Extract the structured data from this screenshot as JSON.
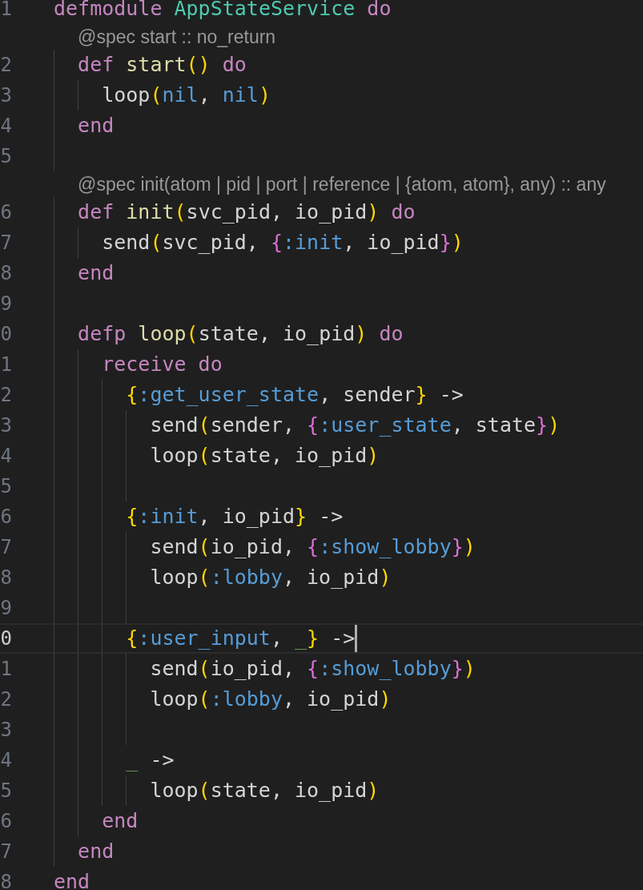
{
  "lines": [
    {
      "kind": "code",
      "number": "1",
      "active": false,
      "tokens": [
        {
          "kind": "keyword",
          "text": "defmodule"
        },
        {
          "kind": "module",
          "text": " AppStateService"
        },
        {
          "kind": "keyword",
          "text": " do"
        }
      ]
    },
    {
      "kind": "codelens",
      "text": "@spec start :: no_return"
    },
    {
      "kind": "code",
      "number": "2",
      "active": false,
      "tokens": [
        {
          "kind": "keyword",
          "text": "  def"
        },
        {
          "kind": "function",
          "text": " start"
        },
        {
          "kind": "bracket1",
          "text": "()"
        },
        {
          "kind": "keyword",
          "text": " do"
        }
      ]
    },
    {
      "kind": "code",
      "number": "3",
      "active": false,
      "tokens": [
        {
          "kind": "text",
          "text": "    loop"
        },
        {
          "kind": "bracket1",
          "text": "("
        },
        {
          "kind": "atom",
          "text": "nil"
        },
        {
          "kind": "text",
          "text": ", "
        },
        {
          "kind": "atom",
          "text": "nil"
        },
        {
          "kind": "bracket1",
          "text": ")"
        }
      ]
    },
    {
      "kind": "code",
      "number": "4",
      "active": false,
      "tokens": [
        {
          "kind": "keyword",
          "text": "  end"
        }
      ]
    },
    {
      "kind": "code",
      "number": "5",
      "active": false
    },
    {
      "kind": "codelens",
      "text": "@spec init(atom | pid | port | reference | {atom, atom}, any) :: any"
    },
    {
      "kind": "code",
      "number": "6",
      "active": false,
      "tokens": [
        {
          "kind": "keyword",
          "text": "  def"
        },
        {
          "kind": "function",
          "text": " init"
        },
        {
          "kind": "bracket1",
          "text": "("
        },
        {
          "kind": "text",
          "text": "svc_pid, io_pid"
        },
        {
          "kind": "bracket1",
          "text": ")"
        },
        {
          "kind": "keyword",
          "text": " do"
        }
      ]
    },
    {
      "kind": "code",
      "number": "7",
      "active": false,
      "tokens": [
        {
          "kind": "text",
          "text": "    send"
        },
        {
          "kind": "bracket1",
          "text": "("
        },
        {
          "kind": "text",
          "text": "svc_pid, "
        },
        {
          "kind": "bracket2",
          "text": "{"
        },
        {
          "kind": "atom",
          "text": ":init"
        },
        {
          "kind": "text",
          "text": ", io_pid"
        },
        {
          "kind": "bracket2",
          "text": "}"
        },
        {
          "kind": "bracket1",
          "text": ")"
        }
      ]
    },
    {
      "kind": "code",
      "number": "8",
      "active": false,
      "tokens": [
        {
          "kind": "keyword",
          "text": "  end"
        }
      ]
    },
    {
      "kind": "code",
      "number": "9",
      "active": false
    },
    {
      "kind": "code",
      "number": "0",
      "active": false,
      "tokens": [
        {
          "kind": "keyword",
          "text": "  defp"
        },
        {
          "kind": "function",
          "text": " loop"
        },
        {
          "kind": "bracket1",
          "text": "("
        },
        {
          "kind": "text",
          "text": "state, io_pid"
        },
        {
          "kind": "bracket1",
          "text": ")"
        },
        {
          "kind": "keyword",
          "text": " do"
        }
      ]
    },
    {
      "kind": "code",
      "number": "1",
      "active": false,
      "tokens": [
        {
          "kind": "keyword",
          "text": "    receive do"
        }
      ]
    },
    {
      "kind": "code",
      "number": "2",
      "active": false,
      "tokens": [
        {
          "kind": "bracket1",
          "text": "      {"
        },
        {
          "kind": "atom",
          "text": ":get_user_state"
        },
        {
          "kind": "text",
          "text": ", sender"
        },
        {
          "kind": "bracket1",
          "text": "}"
        },
        {
          "kind": "text",
          "text": " ->"
        }
      ]
    },
    {
      "kind": "code",
      "number": "3",
      "active": false,
      "tokens": [
        {
          "kind": "text",
          "text": "        send"
        },
        {
          "kind": "bracket1",
          "text": "("
        },
        {
          "kind": "text",
          "text": "sender, "
        },
        {
          "kind": "bracket2",
          "text": "{"
        },
        {
          "kind": "atom",
          "text": ":user_state"
        },
        {
          "kind": "text",
          "text": ", state"
        },
        {
          "kind": "bracket2",
          "text": "}"
        },
        {
          "kind": "bracket1",
          "text": ")"
        }
      ]
    },
    {
      "kind": "code",
      "number": "4",
      "active": false,
      "tokens": [
        {
          "kind": "text",
          "text": "        loop"
        },
        {
          "kind": "bracket1",
          "text": "("
        },
        {
          "kind": "text",
          "text": "state, io_pid"
        },
        {
          "kind": "bracket1",
          "text": ")"
        }
      ]
    },
    {
      "kind": "code",
      "number": "5",
      "active": false
    },
    {
      "kind": "code",
      "number": "6",
      "active": false,
      "tokens": [
        {
          "kind": "bracket1",
          "text": "      {"
        },
        {
          "kind": "atom",
          "text": ":init"
        },
        {
          "kind": "text",
          "text": ", io_pid"
        },
        {
          "kind": "bracket1",
          "text": "}"
        },
        {
          "kind": "text",
          "text": " ->"
        }
      ]
    },
    {
      "kind": "code",
      "number": "7",
      "active": false,
      "tokens": [
        {
          "kind": "text",
          "text": "        send"
        },
        {
          "kind": "bracket1",
          "text": "("
        },
        {
          "kind": "text",
          "text": "io_pid, "
        },
        {
          "kind": "bracket2",
          "text": "{"
        },
        {
          "kind": "atom",
          "text": ":show_lobby"
        },
        {
          "kind": "bracket2",
          "text": "}"
        },
        {
          "kind": "bracket1",
          "text": ")"
        }
      ]
    },
    {
      "kind": "code",
      "number": "8",
      "active": false,
      "tokens": [
        {
          "kind": "text",
          "text": "        loop"
        },
        {
          "kind": "bracket1",
          "text": "("
        },
        {
          "kind": "atom",
          "text": ":lobby"
        },
        {
          "kind": "text",
          "text": ", io_pid"
        },
        {
          "kind": "bracket1",
          "text": ")"
        }
      ]
    },
    {
      "kind": "code",
      "number": "9",
      "active": false
    },
    {
      "kind": "code",
      "number": "0",
      "active": true,
      "tokens": [
        {
          "kind": "bracket1",
          "text": "      {"
        },
        {
          "kind": "atom",
          "text": ":user_input"
        },
        {
          "kind": "text",
          "text": ", "
        },
        {
          "kind": "discard",
          "text": "_"
        },
        {
          "kind": "bracket1",
          "text": "}"
        },
        {
          "kind": "text",
          "text": " ->"
        }
      ]
    },
    {
      "kind": "code",
      "number": "1",
      "active": false,
      "tokens": [
        {
          "kind": "text",
          "text": "        send"
        },
        {
          "kind": "bracket1",
          "text": "("
        },
        {
          "kind": "text",
          "text": "io_pid, "
        },
        {
          "kind": "bracket2",
          "text": "{"
        },
        {
          "kind": "atom",
          "text": ":show_lobby"
        },
        {
          "kind": "bracket2",
          "text": "}"
        },
        {
          "kind": "bracket1",
          "text": ")"
        }
      ]
    },
    {
      "kind": "code",
      "number": "2",
      "active": false,
      "tokens": [
        {
          "kind": "text",
          "text": "        loop"
        },
        {
          "kind": "bracket1",
          "text": "("
        },
        {
          "kind": "atom",
          "text": ":lobby"
        },
        {
          "kind": "text",
          "text": ", io_pid"
        },
        {
          "kind": "bracket1",
          "text": ")"
        }
      ]
    },
    {
      "kind": "code",
      "number": "3",
      "active": false
    },
    {
      "kind": "code",
      "number": "4",
      "active": false,
      "tokens": [
        {
          "kind": "discard",
          "text": "      _"
        },
        {
          "kind": "text",
          "text": " ->"
        }
      ]
    },
    {
      "kind": "code",
      "number": "5",
      "active": false,
      "tokens": [
        {
          "kind": "text",
          "text": "        loop"
        },
        {
          "kind": "bracket1",
          "text": "("
        },
        {
          "kind": "text",
          "text": "state, io_pid"
        },
        {
          "kind": "bracket1",
          "text": ")"
        }
      ]
    },
    {
      "kind": "code",
      "number": "6",
      "active": false,
      "tokens": [
        {
          "kind": "keyword",
          "text": "    end"
        }
      ]
    },
    {
      "kind": "code",
      "number": "7",
      "active": false,
      "tokens": [
        {
          "kind": "keyword",
          "text": "  end"
        }
      ]
    },
    {
      "kind": "code",
      "number": "8",
      "active": false,
      "tokens": [
        {
          "kind": "keyword",
          "text": "end"
        }
      ]
    }
  ]
}
